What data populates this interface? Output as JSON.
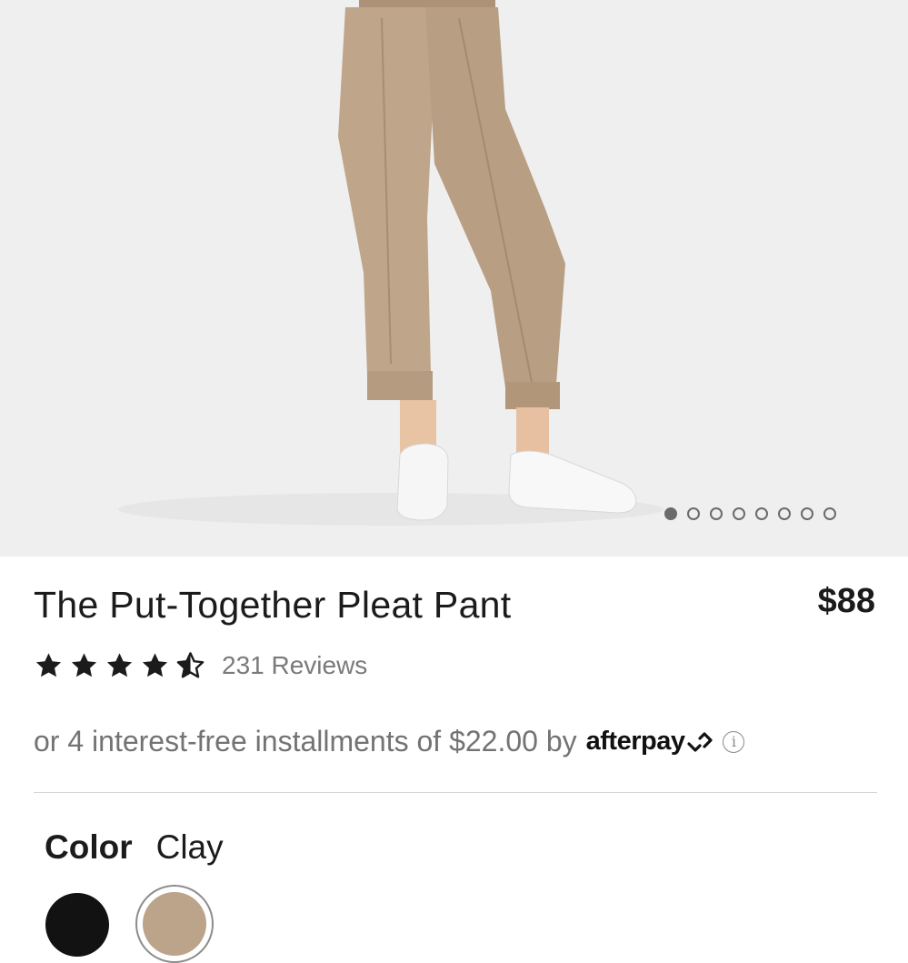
{
  "carousel": {
    "image_alt": "Model wearing The Put-Together Pleat Pant in Clay with white sneakers",
    "total_slides": 8,
    "active_slide": 1
  },
  "product": {
    "title": "The Put-Together Pleat Pant",
    "price": "$88",
    "rating": 4.5,
    "reviews_text": "231 Reviews"
  },
  "installments": {
    "text": "or 4 interest-free installments of $22.00 by",
    "provider": "afterpay",
    "info_icon": "info-icon"
  },
  "color": {
    "label": "Color",
    "selected": "Clay",
    "swatches": [
      {
        "name": "Black",
        "hex": "#121212"
      },
      {
        "name": "Clay",
        "hex": "#bba48a"
      }
    ]
  },
  "colors": {
    "hero_bg": "#efefef",
    "pant": "#bfa58a",
    "text": "#1b1b1b",
    "muted": "#737373"
  }
}
